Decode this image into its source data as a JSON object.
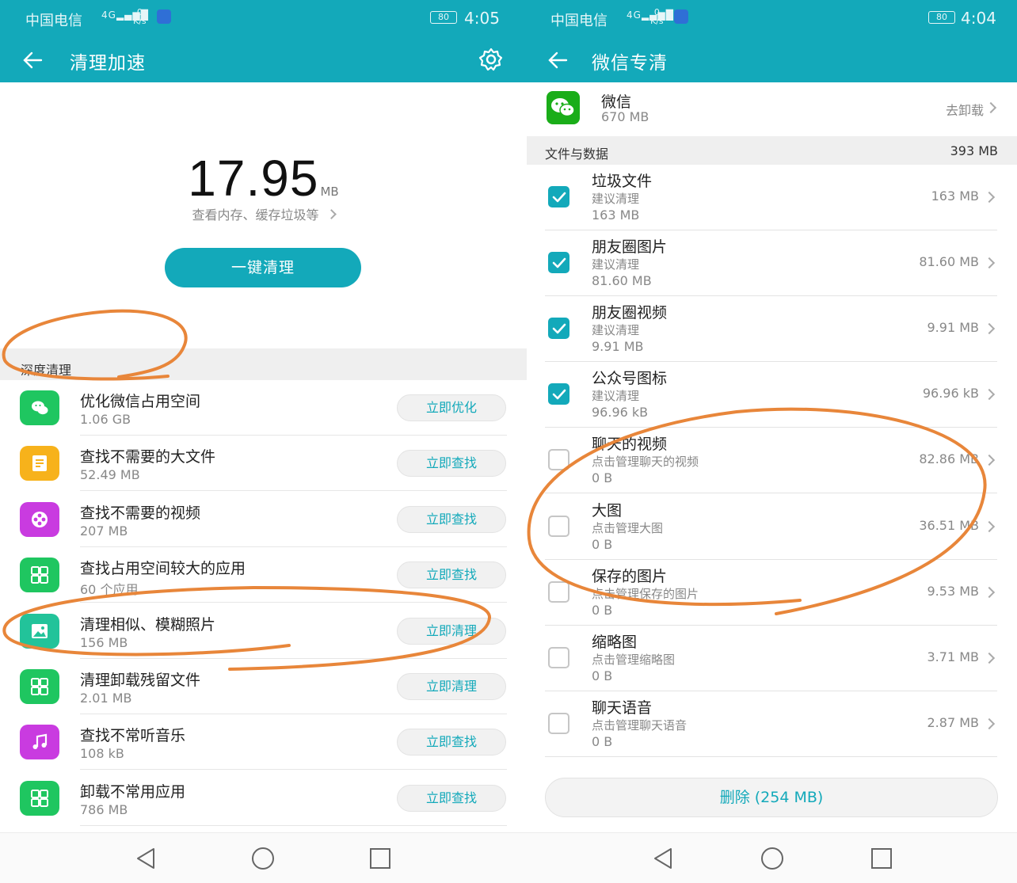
{
  "left": {
    "status": {
      "carrier": "中国电信",
      "network": "4G",
      "speed_value": "0",
      "speed_unit": "K/s",
      "battery": "80",
      "time": "4:05"
    },
    "appbar": {
      "title": "清理加速"
    },
    "summary": {
      "value": "17.95",
      "unit": "MB",
      "subtitle": "查看内存、缓存垃圾等"
    },
    "one_key_button": "一键清理",
    "section_title": "深度清理",
    "items": [
      {
        "title": "优化微信占用空间",
        "detail": "1.06 GB",
        "button": "立即优化",
        "icon": "wechat-icon",
        "color": "#1fc660"
      },
      {
        "title": "查找不需要的大文件",
        "detail": "52.49 MB",
        "button": "立即查找",
        "icon": "document-icon",
        "color": "#f7b21b"
      },
      {
        "title": "查找不需要的视频",
        "detail": "207 MB",
        "button": "立即查找",
        "icon": "film-reel-icon",
        "color": "#c93be0"
      },
      {
        "title": "查找占用空间较大的应用",
        "detail": "60 个应用",
        "button": "立即查找",
        "icon": "app-grid-icon",
        "color": "#1fc660"
      },
      {
        "title": "清理相似、模糊照片",
        "detail": "156 MB",
        "button": "立即清理",
        "icon": "photo-icon",
        "color": "#22c39a"
      },
      {
        "title": "清理卸载残留文件",
        "detail": "2.01 MB",
        "button": "立即清理",
        "icon": "app-grid-icon",
        "color": "#1fc660"
      },
      {
        "title": "查找不常听音乐",
        "detail": "108 kB",
        "button": "立即查找",
        "icon": "music-note-icon",
        "color": "#c93be0"
      },
      {
        "title": "卸载不常用应用",
        "detail": "786 MB",
        "button": "立即查找",
        "icon": "app-grid-icon",
        "color": "#1fc660"
      }
    ]
  },
  "right": {
    "status": {
      "carrier": "中国电信",
      "network": "4G",
      "speed_value": "0",
      "speed_unit": "K/s",
      "battery": "80",
      "time": "4:04"
    },
    "appbar": {
      "title": "微信专清"
    },
    "app": {
      "name": "微信",
      "size": "670 MB",
      "action": "去卸载"
    },
    "files_header": {
      "label": "文件与数据",
      "total": "393 MB"
    },
    "files": [
      {
        "title": "垃圾文件",
        "hint": "建议清理",
        "amount": "163 MB",
        "value": "163 MB",
        "checked": true
      },
      {
        "title": "朋友圈图片",
        "hint": "建议清理",
        "amount": "81.60 MB",
        "value": "81.60 MB",
        "checked": true
      },
      {
        "title": "朋友圈视频",
        "hint": "建议清理",
        "amount": "9.91 MB",
        "value": "9.91 MB",
        "checked": true
      },
      {
        "title": "公众号图标",
        "hint": "建议清理",
        "amount": "96.96 kB",
        "value": "96.96 kB",
        "checked": true
      },
      {
        "title": "聊天的视频",
        "hint": "点击管理聊天的视频",
        "amount": "0 B",
        "value": "82.86 MB",
        "checked": false
      },
      {
        "title": "大图",
        "hint": "点击管理大图",
        "amount": "0 B",
        "value": "36.51 MB",
        "checked": false
      },
      {
        "title": "保存的图片",
        "hint": "点击管理保存的图片",
        "amount": "0 B",
        "value": "9.53 MB",
        "checked": false
      },
      {
        "title": "缩略图",
        "hint": "点击管理缩略图",
        "amount": "0 B",
        "value": "3.71 MB",
        "checked": false
      },
      {
        "title": "聊天语音",
        "hint": "点击管理聊天语音",
        "amount": "0 B",
        "value": "2.87 MB",
        "checked": false
      }
    ],
    "delete_button": "删除 (254 MB)"
  },
  "colors": {
    "accent": "#13a9ba",
    "annotation": "#e8863a"
  }
}
